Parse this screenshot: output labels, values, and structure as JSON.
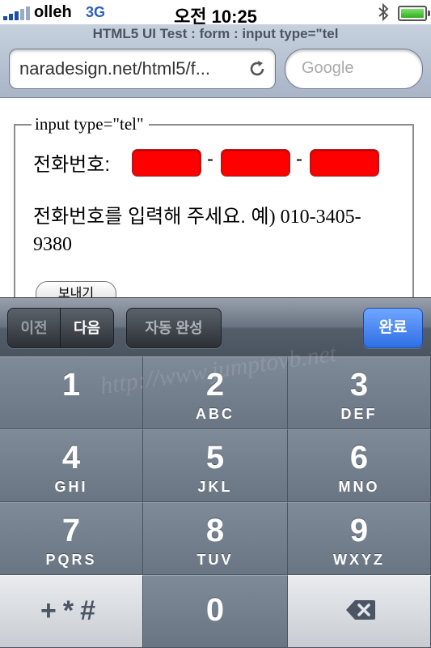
{
  "status_bar": {
    "carrier": "olleh",
    "network": "3G",
    "time": "오전 10:25"
  },
  "browser": {
    "page_title": "HTML5 UI Test : form : input type=\"tel",
    "url": "naradesign.net/html5/f...",
    "search_placeholder": "Google"
  },
  "form": {
    "legend": "input type=\"tel\"",
    "phone_label": "전화번호:",
    "separator": "-",
    "hint_korean": "전화번호를 입력해 주세요. 예",
    "hint_example": ") 010-3405-9380",
    "submit_label": "보내기"
  },
  "form_assistant": {
    "prev_label": "이전",
    "next_label": "다음",
    "autofill_label": "자동 완성",
    "done_label": "완료"
  },
  "keypad": {
    "keys": [
      {
        "num": "1",
        "letters": ""
      },
      {
        "num": "2",
        "letters": "ABC"
      },
      {
        "num": "3",
        "letters": "DEF"
      },
      {
        "num": "4",
        "letters": "GHI"
      },
      {
        "num": "5",
        "letters": "JKL"
      },
      {
        "num": "6",
        "letters": "MNO"
      },
      {
        "num": "7",
        "letters": "PQRS"
      },
      {
        "num": "8",
        "letters": "TUV"
      },
      {
        "num": "9",
        "letters": "WXYZ"
      }
    ],
    "symbols_label": "+*#",
    "zero_label": "0",
    "backspace_icon": "backspace-icon"
  },
  "watermark": "http://www.jumptovb.net",
  "colors": {
    "phone_field": "#ff0000",
    "done_button": "#2f6fe6",
    "keypad": "#6a7584"
  }
}
